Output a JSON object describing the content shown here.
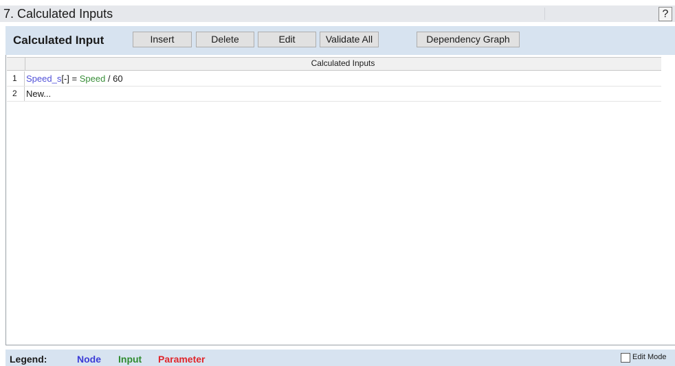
{
  "section": {
    "title": "7. Calculated Inputs",
    "help": "?"
  },
  "toolbar": {
    "title": "Calculated Input",
    "buttons": [
      "Insert",
      "Delete",
      "Edit",
      "Validate All",
      "Dependency Graph"
    ]
  },
  "grid": {
    "header": "Calculated Inputs",
    "rows": [
      {
        "num": "1",
        "expression": {
          "node": "Speed_s",
          "unit": "[-]",
          "op": " = ",
          "input": "Speed",
          "rest": " / 60"
        }
      },
      {
        "num": "2",
        "text": "New..."
      }
    ]
  },
  "legend": {
    "label": "Legend:",
    "items": [
      {
        "label": "Node",
        "color": "#3b3bd6"
      },
      {
        "label": "Input",
        "color": "#2e8b2e"
      },
      {
        "label": "Parameter",
        "color": "#e0262b"
      }
    ],
    "edit_mode_label": "Edit Mode",
    "edit_mode_checked": false
  }
}
